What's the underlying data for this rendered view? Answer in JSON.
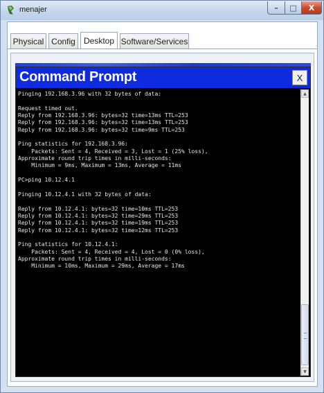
{
  "window": {
    "title": "menajer",
    "buttons": {
      "minimize": "–",
      "maximize": "□",
      "close": "X"
    }
  },
  "tabs": [
    {
      "label": "Physical",
      "active": false
    },
    {
      "label": "Config",
      "active": false
    },
    {
      "label": "Desktop",
      "active": true
    },
    {
      "label": "Software/Services",
      "active": false
    }
  ],
  "command_prompt": {
    "title": "Command Prompt",
    "close_label": "X",
    "lines": [
      "Pinging 192.168.3.96 with 32 bytes of data:",
      "",
      "Request timed out.",
      "Reply from 192.168.3.96: bytes=32 time=13ms TTL=253",
      "Reply from 192.168.3.96: bytes=32 time=13ms TTL=253",
      "Reply from 192.168.3.96: bytes=32 time=9ms TTL=253",
      "",
      "Ping statistics for 192.168.3.96:",
      "    Packets: Sent = 4, Received = 3, Lost = 1 (25% loss),",
      "Approximate round trip times in milli-seconds:",
      "    Minimum = 9ms, Maximum = 13ms, Average = 11ms",
      "",
      "PC>ping 10.12.4.1",
      "",
      "Pinging 10.12.4.1 with 32 bytes of data:",
      "",
      "Reply from 10.12.4.1: bytes=32 time=10ms TTL=253",
      "Reply from 10.12.4.1: bytes=32 time=29ms TTL=253",
      "Reply from 10.12.4.1: bytes=32 time=19ms TTL=253",
      "Reply from 10.12.4.1: bytes=32 time=12ms TTL=253",
      "",
      "Ping statistics for 10.12.4.1:",
      "    Packets: Sent = 4, Received = 4, Lost = 0 (0% loss),",
      "Approximate round trip times in milli-seconds:",
      "    Minimum = 10ms, Maximum = 29ms, Average = 17ms"
    ]
  },
  "colors": {
    "cmd_title_bar": "#0f2be0",
    "console_bg": "#000000",
    "console_text": "#e8e8e8"
  },
  "icons": {
    "app": "packet-tracer-pc-icon",
    "scroll_up": "arrow-up-icon",
    "scroll_down": "arrow-down-icon"
  }
}
